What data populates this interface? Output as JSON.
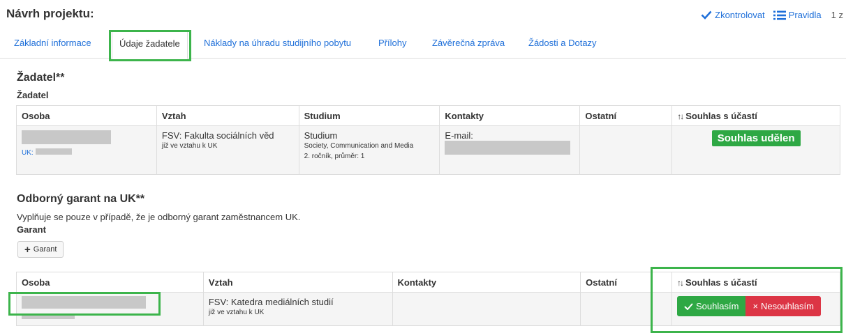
{
  "header": {
    "title": "Návrh projektu:",
    "actions": {
      "check_label": "Zkontrolovat",
      "rules_label": "Pravidla",
      "pager_text": "1 z"
    }
  },
  "tabs": [
    {
      "label": "Základní informace"
    },
    {
      "label": "Údaje žadatele"
    },
    {
      "label": "Náklady na úhradu studijního pobytu"
    },
    {
      "label": "Přílohy"
    },
    {
      "label": "Závěrečná zpráva"
    },
    {
      "label": "Žádosti a Dotazy"
    }
  ],
  "applicant_section": {
    "title": "Žadatel**",
    "subtitle": "Žadatel",
    "columns": [
      "Osoba",
      "Vztah",
      "Studium",
      "Kontakty",
      "Ostatní",
      "Souhlas s účastí"
    ],
    "row": {
      "uk_label": "UK:",
      "relation": "FSV: Fakulta sociálních věd",
      "relation_sub": "již ve vztahu k UK",
      "study": "Studium",
      "study_program": "Society, Communication and Media",
      "study_year": "2. ročník, průměr: 1",
      "contact_label": "E-mail:",
      "consent_badge": "Souhlas udělen"
    }
  },
  "guarantor_section": {
    "title": "Odborný garant na UK**",
    "note": "Vyplňuje se pouze v případě, že je odborný garant zaměstnancem UK.",
    "subtitle": "Garant",
    "add_button": "Garant",
    "columns": [
      "Osoba",
      "Vztah",
      "Kontakty",
      "Ostatní",
      "Souhlas s účastí"
    ],
    "row": {
      "relation": "FSV: Katedra mediálních studií",
      "relation_sub": "již ve vztahu k UK",
      "agree_label": "Souhlasím",
      "disagree_label": "Nesouhlasím"
    }
  },
  "colors": {
    "link": "#1e6fd9",
    "success": "#2ea844",
    "danger": "#dc3545",
    "highlight": "#3cb44b"
  }
}
